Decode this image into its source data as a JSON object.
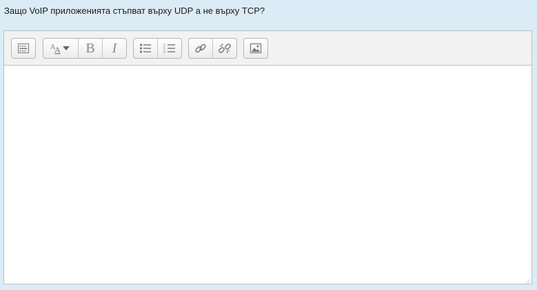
{
  "question": {
    "text": "Защо VoIP приложенията стъпват върху UDP а не върху TCP?"
  },
  "toolbar": {
    "bold_glyph": "B",
    "italic_glyph": "I",
    "buttons": [
      {
        "name": "toolbar-toggle",
        "icon": "toolbar-toggle-icon"
      },
      {
        "name": "text-style",
        "icon": "font-style-icon"
      },
      {
        "name": "bold",
        "icon": "bold-icon"
      },
      {
        "name": "italic",
        "icon": "italic-icon"
      },
      {
        "name": "unordered-list",
        "icon": "bullet-list-icon"
      },
      {
        "name": "ordered-list",
        "icon": "numbered-list-icon"
      },
      {
        "name": "link",
        "icon": "link-icon"
      },
      {
        "name": "unlink",
        "icon": "unlink-icon"
      },
      {
        "name": "image",
        "icon": "image-icon"
      }
    ]
  },
  "editor": {
    "content": ""
  },
  "colors": {
    "page_bg": "#dcecf6",
    "toolbar_bg": "#f2f2f2",
    "icon": "#8a8a8a"
  }
}
